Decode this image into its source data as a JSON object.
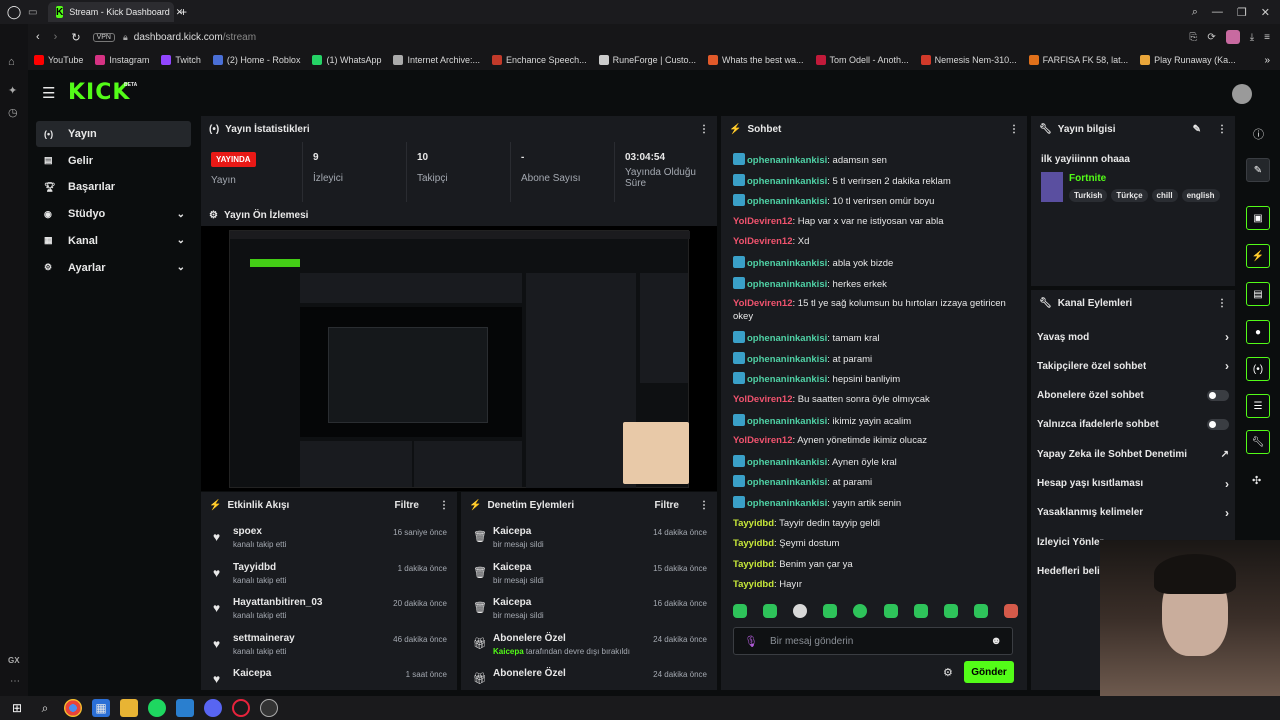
{
  "browser": {
    "tab_title": "Stream - Kick Dashboard",
    "url_host": "dashboard.kick.com",
    "url_path": "/stream",
    "vpn": "VPN",
    "bookmarks": [
      "YouTube",
      "Instagram",
      "Twitch",
      "(2) Home - Roblox",
      "(1) WhatsApp",
      "Internet Archive:...",
      "Enchance Speech...",
      "RuneForge | Custo...",
      "Whats the best wa...",
      "Tom Odell - Anoth...",
      "Nemesis Nem-310...",
      "FARFISA FK 58, lat...",
      "Play Runaway (Ka..."
    ],
    "side_label": "GX"
  },
  "header": {
    "logo": "KICK",
    "beta": "BETA"
  },
  "nav": [
    {
      "label": "Yayın",
      "icon": "broadcast-icon"
    },
    {
      "label": "Gelir",
      "icon": "revenue-icon"
    },
    {
      "label": "Başarılar",
      "icon": "trophy-icon"
    },
    {
      "label": "Stüdyo",
      "icon": "studio-icon"
    },
    {
      "label": "Kanal",
      "icon": "channel-icon"
    },
    {
      "label": "Ayarlar",
      "icon": "settings-icon"
    }
  ],
  "stats": {
    "title": "Yayın İstatistikleri",
    "live": "YAYINDA",
    "live_label": "Yayın",
    "viewers": "9",
    "viewers_label": "İzleyici",
    "followers": "10",
    "followers_label": "Takipçi",
    "subs": "-",
    "subs_label": "Abone Sayısı",
    "uptime": "03:04:54",
    "uptime_label": "Yayında Olduğu Süre"
  },
  "preview": {
    "title": "Yayın Ön İzlemesi"
  },
  "activity": {
    "title": "Etkinlik Akışı",
    "filter": "Filtre",
    "items": [
      {
        "name": "spoex",
        "sub": "kanalı takip etti",
        "time": "16 saniye önce"
      },
      {
        "name": "Tayyidbd",
        "sub": "kanalı takip etti",
        "time": "1 dakika önce"
      },
      {
        "name": "Hayattanbitiren_03",
        "sub": "kanalı takip etti",
        "time": "20 dakika önce"
      },
      {
        "name": "settmaineray",
        "sub": "kanalı takip etti",
        "time": "46 dakika önce"
      },
      {
        "name": "Kaicepa",
        "sub": "",
        "time": "1 saat önce"
      }
    ]
  },
  "moderation": {
    "title": "Denetim Eylemleri",
    "filter": "Filtre",
    "items": [
      {
        "name": "Kaicepa",
        "sub": "bir mesajı sildi",
        "time": "14 dakika önce",
        "hl": ""
      },
      {
        "name": "Kaicepa",
        "sub": "bir mesajı sildi",
        "time": "15 dakika önce",
        "hl": ""
      },
      {
        "name": "Kaicepa",
        "sub": "bir mesajı sildi",
        "time": "16 dakika önce",
        "hl": ""
      },
      {
        "name": "Abonelere Özel",
        "sub": " tarafından devre dışı bırakıldı",
        "time": "24 dakika önce",
        "hl": "Kaicepa"
      },
      {
        "name": "Abonelere Özel",
        "sub": "",
        "time": "24 dakika önce",
        "hl": ""
      }
    ]
  },
  "chat": {
    "title": "Sohbet",
    "messages": [
      {
        "user": "ophenaninkankisi",
        "text": "adamsın sen",
        "c": "g"
      },
      {
        "user": "ophenaninkankisi",
        "text": "5 tl verirsen 2 dakika reklam",
        "c": "g"
      },
      {
        "user": "ophenaninkankisi",
        "text": "10 tl verirsen omür boyu",
        "c": "g"
      },
      {
        "user": "YolDeviren12",
        "text": "Hap var x var ne istiyosan var abla",
        "c": "r"
      },
      {
        "user": "YolDeviren12",
        "text": "Xd",
        "c": "r"
      },
      {
        "user": "ophenaninkankisi",
        "text": "abla yok bizde",
        "c": "g"
      },
      {
        "user": "ophenaninkankisi",
        "text": "herkes erkek",
        "c": "g"
      },
      {
        "user": "YolDeviren12",
        "text": "15 tl ye sağ kolumsun bu hırtoları izzaya getiricen okey",
        "c": "r"
      },
      {
        "user": "ophenaninkankisi",
        "text": "tamam kral",
        "c": "g"
      },
      {
        "user": "ophenaninkankisi",
        "text": "at parami",
        "c": "g"
      },
      {
        "user": "ophenaninkankisi",
        "text": "hepsini banliyim",
        "c": "g"
      },
      {
        "user": "YolDeviren12",
        "text": "Bu saatten sonra öyle olmıycak",
        "c": "r"
      },
      {
        "user": "ophenaninkankisi",
        "text": "ikimiz yayin acalim",
        "c": "g"
      },
      {
        "user": "YolDeviren12",
        "text": "Aynen yönetimde ikimiz olucaz",
        "c": "r"
      },
      {
        "user": "ophenaninkankisi",
        "text": "Aynen öyle kral",
        "c": "g"
      },
      {
        "user": "ophenaninkankisi",
        "text": "at parami",
        "c": "g"
      },
      {
        "user": "ophenaninkankisi",
        "text": "yayın artik senin",
        "c": "g"
      },
      {
        "user": "Tayyidbd",
        "text": "Tayyir dedin tayyip geldi",
        "c": "y"
      },
      {
        "user": "Tayyidbd",
        "text": "Şeymi dostum",
        "c": "y"
      },
      {
        "user": "Tayyidbd",
        "text": "Benim yan çar ya",
        "c": "y"
      },
      {
        "user": "Tayyidbd",
        "text": "Hayır",
        "c": "y"
      }
    ],
    "placeholder": "Bir mesaj gönderin",
    "send": "Gönder"
  },
  "info": {
    "title": "Yayın bilgisi",
    "stream_title": "ilk yayiiinnn ohaaa",
    "category": "Fortnite",
    "tags": [
      "Turkish",
      "Türkçe",
      "chill",
      "english"
    ]
  },
  "channel_actions": {
    "title": "Kanal Eylemleri",
    "items": [
      {
        "label": "Yavaş mod",
        "ctrl": "chevron"
      },
      {
        "label": "Takipçilere özel sohbet",
        "ctrl": "chevron"
      },
      {
        "label": "Abonelere özel sohbet",
        "ctrl": "toggle"
      },
      {
        "label": "Yalnızca ifadelerle sohbet",
        "ctrl": "toggle"
      },
      {
        "label": "Yapay Zeka ile Sohbet Denetimi",
        "ctrl": "external"
      },
      {
        "label": "Hesap yaşı kısıtlaması",
        "ctrl": "chevron"
      },
      {
        "label": "Yasaklanmış kelimeler",
        "ctrl": "chevron"
      },
      {
        "label": "İzleyici Yönler",
        "ctrl": ""
      },
      {
        "label": "Hedefleri beli",
        "ctrl": ""
      }
    ]
  },
  "colors": {
    "accent": "#53fc18",
    "live": "#e91916",
    "panel": "#191b1f"
  }
}
